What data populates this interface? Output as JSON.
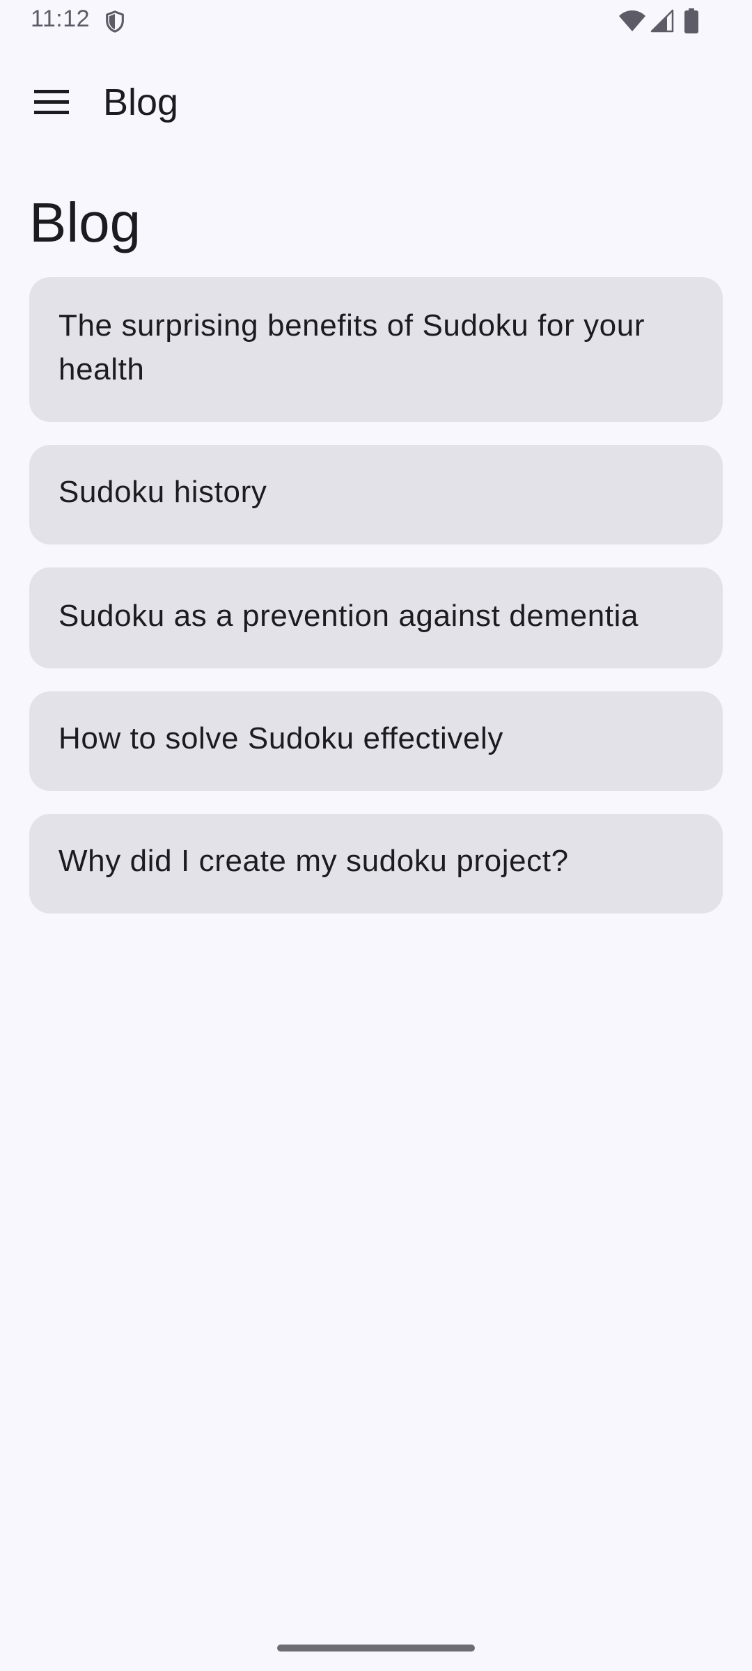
{
  "status_bar": {
    "time": "11:12",
    "icons": [
      "shield-icon",
      "wifi-icon",
      "signal-icon",
      "battery-icon"
    ]
  },
  "app_bar": {
    "menu_icon": "hamburger-menu-icon",
    "title": "Blog"
  },
  "page": {
    "title": "Blog"
  },
  "posts": [
    {
      "title": "The surprising benefits of Sudoku for your health"
    },
    {
      "title": "Sudoku history"
    },
    {
      "title": "Sudoku as a prevention against dementia"
    },
    {
      "title": "How to solve Sudoku effectively"
    },
    {
      "title": "Why did I create my sudoku project?"
    }
  ],
  "colors": {
    "background": "#f8f7fd",
    "card": "#e3e2e8",
    "text": "#1c1b20",
    "status_text": "#5d5b66"
  }
}
